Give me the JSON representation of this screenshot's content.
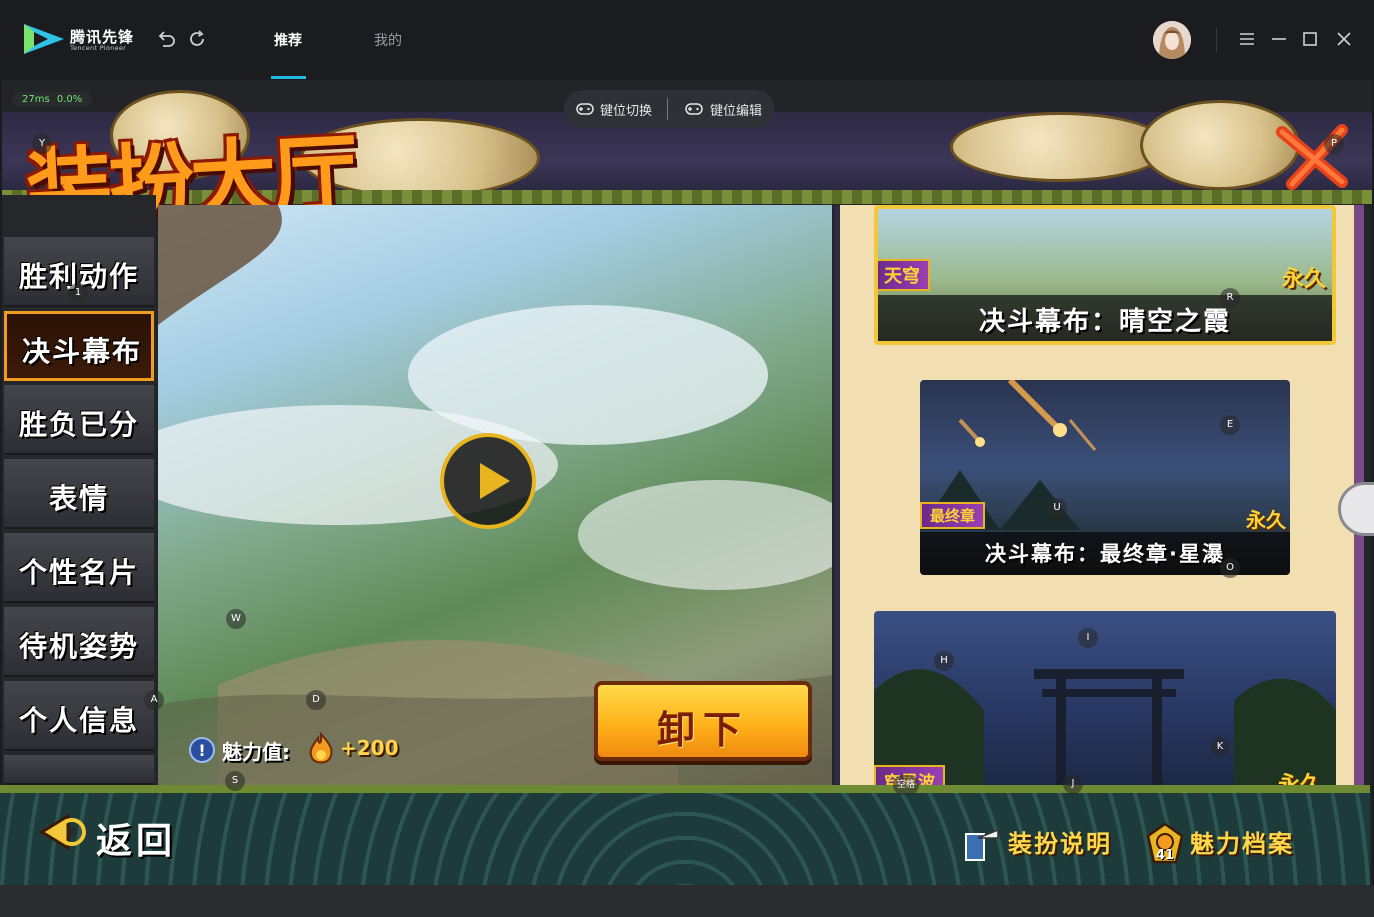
{
  "app": {
    "logo_name": "腾讯先锋",
    "logo_sub": "Tencent Pioneer"
  },
  "tabs": [
    {
      "label": "推荐",
      "active": true
    },
    {
      "label": "我的",
      "active": false
    }
  ],
  "status": {
    "latency": "27ms",
    "loss": "0.0%"
  },
  "keybar": {
    "switch_label": "键位切换",
    "edit_label": "键位编辑"
  },
  "game": {
    "title": "装扮大厅",
    "menu": [
      {
        "label": "胜利动作",
        "selected": false
      },
      {
        "label": "决斗幕布",
        "selected": true
      },
      {
        "label": "胜负已分",
        "selected": false
      },
      {
        "label": "表情",
        "selected": false
      },
      {
        "label": "个性名片",
        "selected": false
      },
      {
        "label": "待机姿势",
        "selected": false
      },
      {
        "label": "个人信息",
        "selected": false
      }
    ],
    "unload_label": "卸下",
    "charm_label": "魅力值:",
    "charm_value": "+200",
    "cards": [
      {
        "tag": "天穹",
        "permanent": "永久",
        "title": "决斗幕布：晴空之霞"
      },
      {
        "tag": "最终章",
        "permanent": "永久",
        "title": "决斗幕布：最终章·星瀑"
      },
      {
        "tag": "穿界波",
        "permanent": "永久",
        "title": ""
      }
    ],
    "back_label": "返回",
    "guide_label": "装扮说明",
    "charm_archive_label": "魅力档案",
    "charm_archive_badge": "41"
  },
  "key_hints": [
    "Y",
    "P",
    "1",
    "R",
    "E",
    "U",
    "O",
    "W",
    "A",
    "D",
    "S",
    "I",
    "H",
    "K",
    "J",
    "空格"
  ],
  "colors": {
    "accent": "#21b8e0",
    "latency_green": "#6fe36a",
    "selected_border": "#f39b1f",
    "button_gold": "#ffb21a"
  }
}
